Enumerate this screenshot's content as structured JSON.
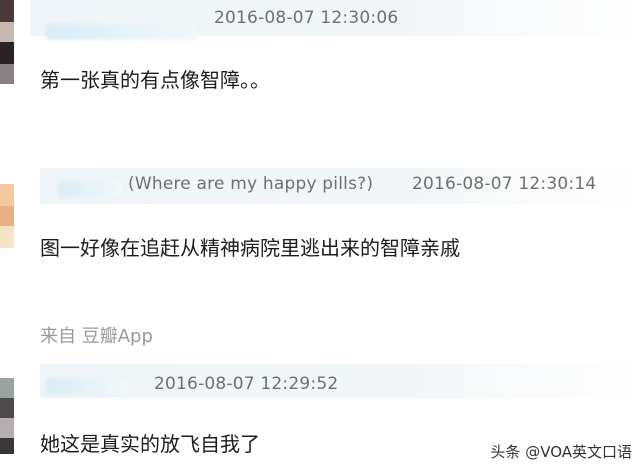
{
  "comments": [
    {
      "timestamp": "2016-08-07 12:30:06",
      "tag": "",
      "text": "第一张真的有点像智障。。"
    },
    {
      "timestamp": "2016-08-07 12:30:14",
      "tag": "(Where are my happy pills?)",
      "text": "图一好像在追赶从精神病院里逃出来的智障亲戚",
      "source": "来自 豆瓣App"
    },
    {
      "timestamp": "2016-08-07 12:29:52",
      "tag": "",
      "text": "她这是真实的放飞自我了"
    }
  ],
  "watermark": "头条 @VOA英文口语",
  "colors": {
    "header_bg": "#eef4f7",
    "meta_text": "#6f6f6f",
    "source_text": "#9a9a9a",
    "body_text": "#1c1c1c"
  }
}
